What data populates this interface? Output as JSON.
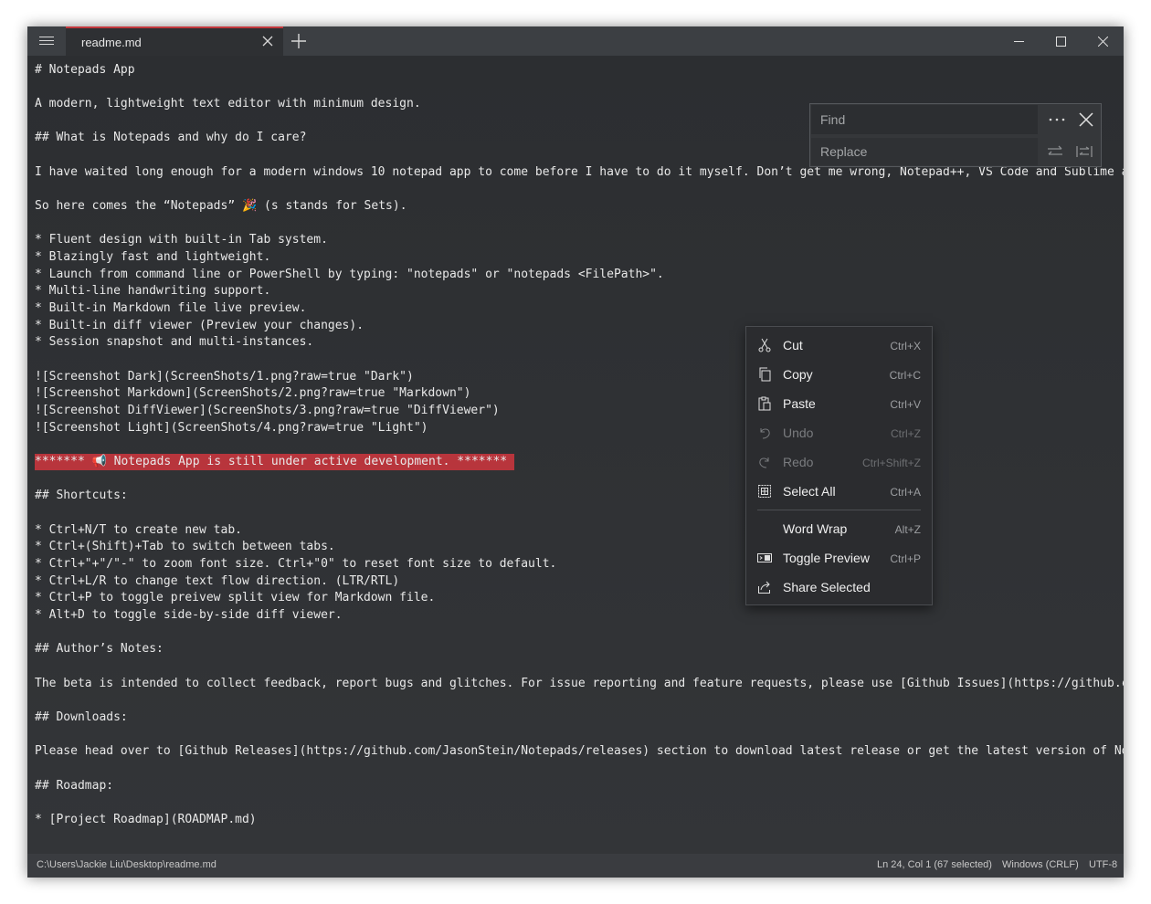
{
  "window": {
    "tab_title": "readme.md"
  },
  "editor": {
    "lines": [
      "# Notepads App",
      "A modern, lightweight text editor with minimum design.",
      "## What is Notepads and why do I care?",
      "I have waited long enough for a modern windows 10 notepad app to come before I have to do it myself. Don’t get me wrong, Notepad++, VS Code and Sublime ar",
      "So here comes the “Notepads” 🎉 (s stands for Sets).",
      "* Fluent design with built-in Tab system.",
      "* Blazingly fast and lightweight.",
      "* Launch from command line or PowerShell by typing: \"notepads\" or \"notepads <FilePath>\".",
      "* Multi-line handwriting support.",
      "* Built-in Markdown file live preview.",
      "* Built-in diff viewer (Preview your changes).",
      "* Session snapshot and multi-instances.",
      "![Screenshot Dark](ScreenShots/1.png?raw=true \"Dark\")",
      "![Screenshot Markdown](ScreenShots/2.png?raw=true \"Markdown\")",
      "![Screenshot DiffViewer](ScreenShots/3.png?raw=true \"DiffViewer\")",
      "![Screenshot Light](ScreenShots/4.png?raw=true \"Light\")",
      "******* 📢 Notepads App is still under active development. *******",
      "## Shortcuts:",
      "* Ctrl+N/T to create new tab.",
      "* Ctrl+(Shift)+Tab to switch between tabs.",
      "* Ctrl+\"+\"/\"-\" to zoom font size. Ctrl+\"0\" to reset font size to default.",
      "* Ctrl+L/R to change text flow direction. (LTR/RTL)",
      "* Ctrl+P to toggle preivew split view for Markdown file.",
      "* Alt+D to toggle side-by-side diff viewer.",
      "## Author’s Notes:",
      "The beta is intended to collect feedback, report bugs and glitches. For issue reporting and feature requests, please use [Github Issues](https://github.cc",
      "## Downloads:",
      "Please head over to [Github Releases](https://github.com/JasonStein/Notepads/releases) section to download latest release or get the latest version of Not",
      "## Roadmap:",
      "* [Project Roadmap](ROADMAP.md)"
    ]
  },
  "find": {
    "find_placeholder": "Find",
    "replace_placeholder": "Replace"
  },
  "context_menu": {
    "items": [
      {
        "label": "Cut",
        "shortcut": "Ctrl+X",
        "icon": "scissors-icon"
      },
      {
        "label": "Copy",
        "shortcut": "Ctrl+C",
        "icon": "copy-icon"
      },
      {
        "label": "Paste",
        "shortcut": "Ctrl+V",
        "icon": "paste-icon"
      },
      {
        "label": "Undo",
        "shortcut": "Ctrl+Z",
        "icon": "undo-icon"
      },
      {
        "label": "Redo",
        "shortcut": "Ctrl+Shift+Z",
        "icon": "redo-icon"
      },
      {
        "label": "Select All",
        "shortcut": "Ctrl+A",
        "icon": "select-all-icon"
      },
      {
        "label": "Word Wrap",
        "shortcut": "Alt+Z",
        "icon": ""
      },
      {
        "label": "Toggle Preview",
        "shortcut": "Ctrl+P",
        "icon": "preview-icon"
      },
      {
        "label": "Share Selected",
        "shortcut": "",
        "icon": "share-icon"
      }
    ]
  },
  "status": {
    "path": "C:\\Users\\Jackie Liu\\Desktop\\readme.md",
    "position": "Ln 24, Col 1 (67 selected)",
    "line_ending": "Windows (CRLF)",
    "encoding": "UTF-8"
  },
  "colors": {
    "accent": "#c2373c",
    "highlight": "#b8353c",
    "background": "#2e3033"
  }
}
